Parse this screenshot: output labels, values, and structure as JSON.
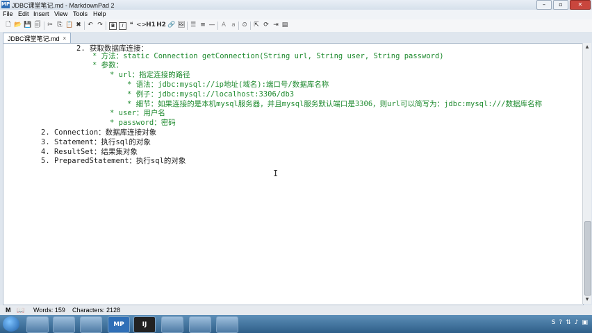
{
  "window": {
    "title": "JDBC课堂笔记.md - MarkdownPad 2",
    "app_icon": "MP",
    "controls": [
      "–",
      "▫",
      "✕"
    ]
  },
  "menu": [
    "File",
    "Edit",
    "Insert",
    "View",
    "Tools",
    "Help"
  ],
  "toolbar": {
    "h1": "H1",
    "h2": "H2",
    "bold": "B",
    "italic": "I",
    "code": "<>",
    "upper": "A",
    "lower": "a"
  },
  "tab": {
    "label": "JDBC课堂笔记.md",
    "close": "×"
  },
  "editor": {
    "lines": [
      {
        "text": "2. 获取数据库连接：",
        "color": "dark"
      },
      {
        "text": "* 方法：static Connection getConnection(String url, String user, String password)",
        "color": "green"
      },
      {
        "text": "* 参数：",
        "color": "green"
      },
      {
        "text": "* url：指定连接的路径",
        "color": "green"
      },
      {
        "text": "* 语法：jdbc:mysql://ip地址(域名):端口号/数据库名称",
        "color": "green"
      },
      {
        "text": "* 例子：jdbc:mysql://localhost:3306/db3",
        "color": "green"
      },
      {
        "text": "* 细节：如果连接的是本机mysql服务器，并且mysql服务默认端口是3306，则url可以简写为：jdbc:mysql:///数据库名称",
        "color": "green"
      },
      {
        "text": "* user：用户名",
        "color": "green"
      },
      {
        "text": "* password：密码",
        "color": "green"
      },
      {
        "text": "2. Connection：数据库连接对象",
        "color": "dark"
      },
      {
        "text": "3. Statement：执行sql的对象",
        "color": "dark"
      },
      {
        "text": "4. ResultSet：结果集对象",
        "color": "dark"
      },
      {
        "text": "5. PreparedStatement：执行sql的对象",
        "color": "dark"
      }
    ],
    "cursor_glyph": "I"
  },
  "status": {
    "markdown_icon": "M",
    "book_icon": "📖",
    "words": "Words: 159",
    "characters": "Characters: 2128"
  },
  "taskbar": {
    "mp_label": "MP",
    "ij_label": "IJ"
  },
  "colors": {
    "green": "#1e8a2e",
    "dark": "#222222"
  }
}
